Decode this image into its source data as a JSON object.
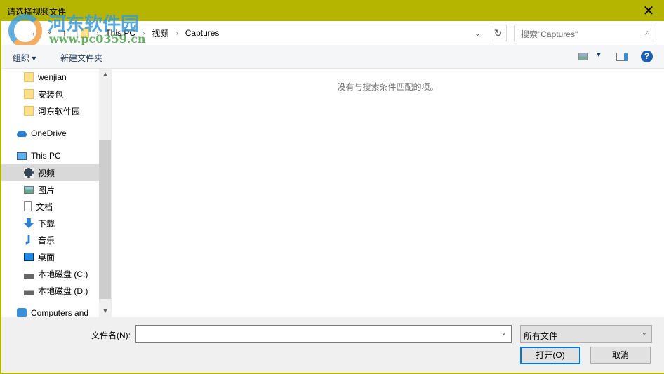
{
  "window": {
    "title": "请选择视频文件",
    "close": "✕"
  },
  "watermark": {
    "name": "河东软件园",
    "url": "www.pc0359.cn"
  },
  "address": {
    "back": "←",
    "forward": "→",
    "recent": "⌄",
    "up": "↑",
    "crumbs": [
      "This PC",
      "视频",
      "Captures"
    ],
    "refresh": "↻",
    "search_placeholder": "搜索\"Captures\"",
    "search_icon": "⌕"
  },
  "toolbar": {
    "organize": "组织 ▾",
    "new_folder": "新建文件夹",
    "help": "?"
  },
  "nav": {
    "items": [
      {
        "label": "wenjian",
        "icon": "folder-icon"
      },
      {
        "label": "安装包",
        "icon": "folder-icon"
      },
      {
        "label": "河东软件园",
        "icon": "folder-icon"
      },
      {
        "label": "OneDrive",
        "icon": "cloud-icon"
      },
      {
        "label": "This PC",
        "icon": "computer-icon"
      },
      {
        "label": "视频",
        "icon": "video-icon",
        "selected": true
      },
      {
        "label": "图片",
        "icon": "picture-icon"
      },
      {
        "label": "文档",
        "icon": "document-icon"
      },
      {
        "label": "下载",
        "icon": "download-icon"
      },
      {
        "label": "音乐",
        "icon": "music-icon"
      },
      {
        "label": "桌面",
        "icon": "desktop-icon"
      },
      {
        "label": "本地磁盘 (C:)",
        "icon": "drive-icon"
      },
      {
        "label": "本地磁盘 (D:)",
        "icon": "drive-icon"
      },
      {
        "label": "Computers and",
        "icon": "network-icon"
      }
    ]
  },
  "content": {
    "empty_message": "没有与搜索条件匹配的项。"
  },
  "bottom": {
    "filename_label": "文件名(N):",
    "filename_value": "",
    "filetype": "所有文件",
    "open": "打开(O)",
    "cancel": "取消"
  },
  "colors": {
    "titlebar": "#b5b500",
    "accent": "#0078d7"
  }
}
